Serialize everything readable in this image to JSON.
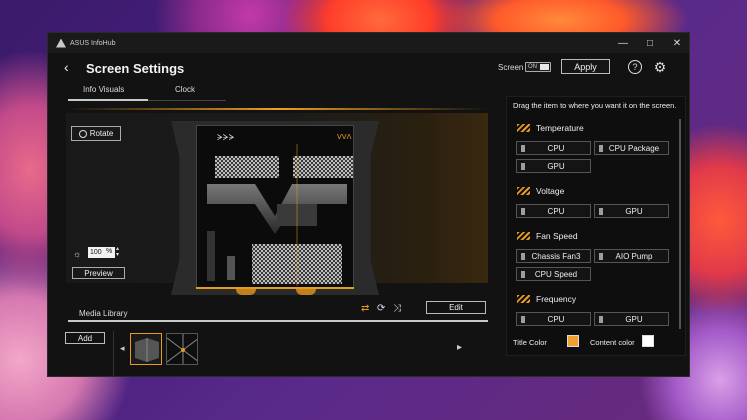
{
  "app": {
    "title": "ASUS InfoHub"
  },
  "window_controls": {
    "minimize": "—",
    "maximize": "□",
    "close": "✕"
  },
  "header": {
    "back_glyph": "‹",
    "title": "Screen Settings",
    "screen_label": "Screen",
    "screen_toggle": "ON",
    "apply_label": "Apply",
    "help_glyph": "?",
    "gear_glyph": "⚙"
  },
  "tabs": [
    {
      "label": "Info Visuals",
      "active": true
    },
    {
      "label": "Clock",
      "active": false
    }
  ],
  "left": {
    "rotate_label": "Rotate",
    "brightness_value": "100",
    "brightness_unit": "%",
    "preview_label": "Preview",
    "device_logo": "ᗒᗒᗒ",
    "device_badge": "ᐯᐯᐱ"
  },
  "media": {
    "label": "Media Library",
    "edit_label": "Edit",
    "add_label": "Add",
    "icons": [
      "⇄",
      "⟳",
      "⤨"
    ]
  },
  "right": {
    "hint": "Drag the item to where you want it on the screen.",
    "sections": [
      {
        "title": "Temperature",
        "items": [
          "CPU",
          "CPU Package",
          "GPU"
        ]
      },
      {
        "title": "Voltage",
        "items": [
          "CPU",
          "GPU"
        ]
      },
      {
        "title": "Fan Speed",
        "items": [
          "Chassis Fan3",
          "AIO Pump",
          "CPU Speed"
        ]
      },
      {
        "title": "Frequency",
        "items": [
          "CPU",
          "GPU"
        ]
      }
    ],
    "title_color_label": "Title Color",
    "content_color_label": "Content color",
    "title_color": "#f0a030",
    "content_color": "#ffffff"
  },
  "colors": {
    "accent": "#e89a20"
  }
}
